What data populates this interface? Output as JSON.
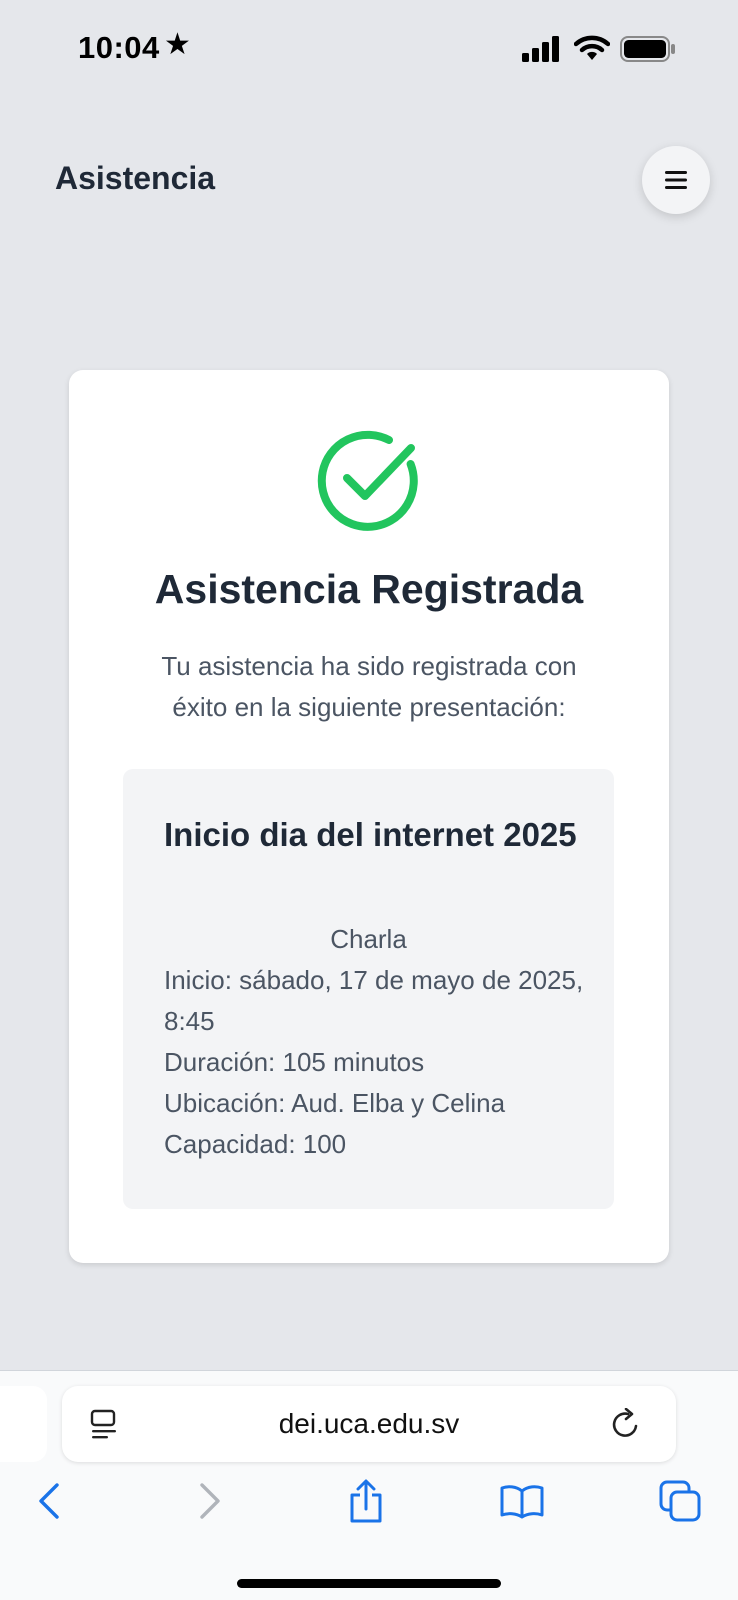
{
  "status_bar": {
    "time": "10:04",
    "star": "★",
    "icons": [
      "cellular-signal-icon",
      "wifi-icon",
      "battery-icon"
    ]
  },
  "header": {
    "title": "Asistencia",
    "menu_icon": "hamburger-menu-icon"
  },
  "card": {
    "icon": "check-circle-icon",
    "title": "Asistencia Registrada",
    "message": "Tu asistencia ha sido registrada con éxito en la siguiente presentación:",
    "event": {
      "title": "Inicio dia del internet 2025",
      "type": "Charla",
      "start": "Inicio: sábado, 17 de mayo de 2025, 8:45",
      "duration": "Duración: 105 minutos",
      "location": "Ubicación: Aud. Elba y Celina",
      "capacity": "Capacidad: 100"
    }
  },
  "browser": {
    "url": "dei.uca.edu.sv",
    "toolbar": [
      "back-icon",
      "forward-icon",
      "share-icon",
      "bookmarks-icon",
      "tabs-icon"
    ]
  },
  "colors": {
    "background": "#e5e7eb",
    "success": "#22c55e",
    "accent": "#1a73e8"
  }
}
